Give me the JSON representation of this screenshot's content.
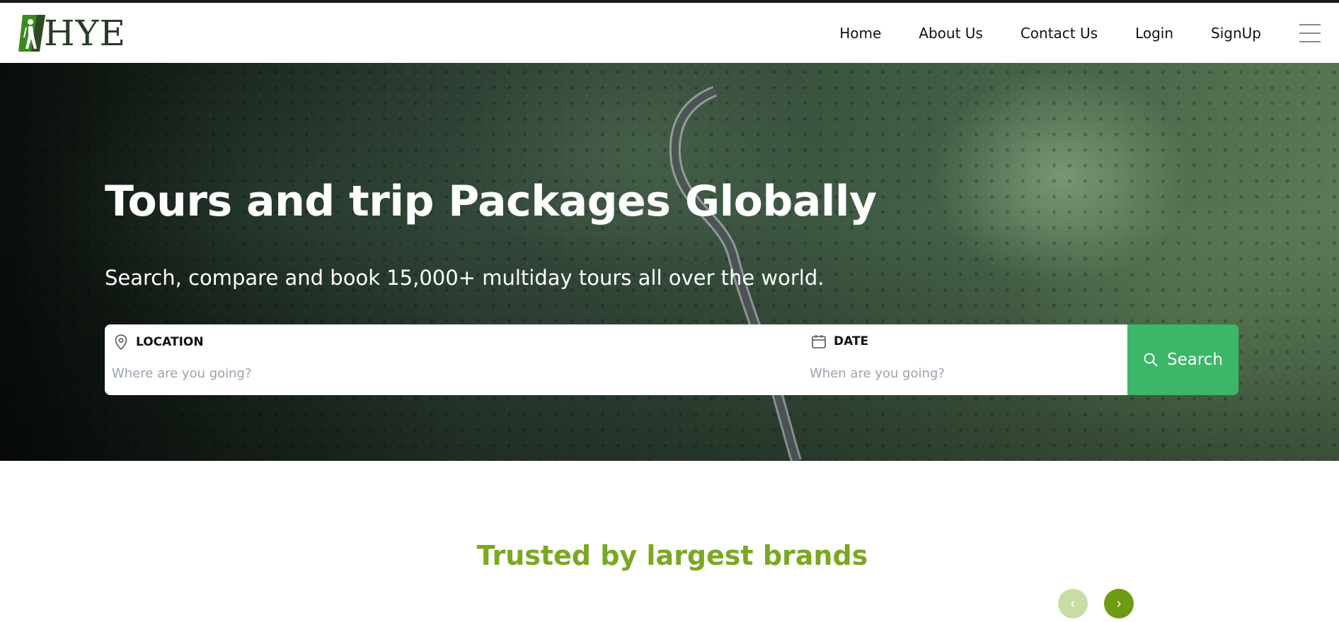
{
  "header": {
    "logo_text": "HYE",
    "nav": [
      {
        "label": "Home"
      },
      {
        "label": "About Us"
      },
      {
        "label": "Contact Us"
      },
      {
        "label": "Login"
      },
      {
        "label": "SignUp"
      }
    ]
  },
  "hero": {
    "title": "Tours and trip Packages Globally",
    "subtitle": "Search, compare and book 15,000+ multiday tours all over the world."
  },
  "search": {
    "location_label": "LOCATION",
    "location_placeholder": "Where are you going?",
    "date_label": "DATE",
    "date_placeholder": "When are you going?",
    "button_label": "Search",
    "button_color": "#3cb669"
  },
  "trusted": {
    "title": "Trusted by largest brands",
    "prev_icon": "‹",
    "next_icon": "›",
    "accent_color": "#7aa822"
  }
}
